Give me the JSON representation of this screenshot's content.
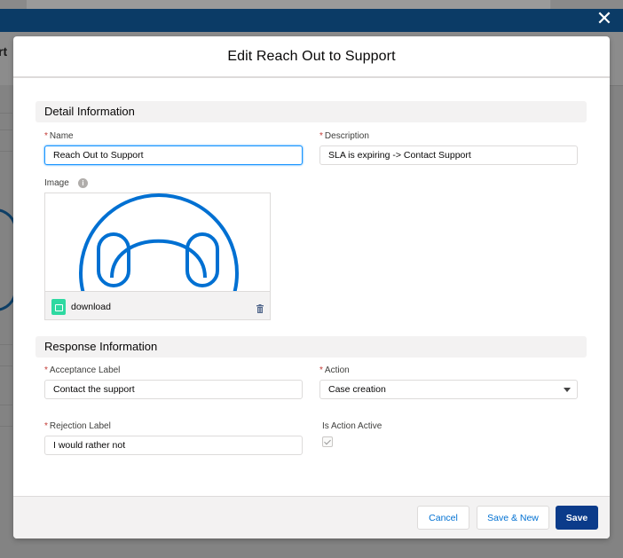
{
  "modal": {
    "title": "Edit Reach Out to Support",
    "close_icon": "close-icon"
  },
  "background": {
    "partial_title": "rt"
  },
  "detail_section": {
    "title": "Detail Information",
    "name": {
      "label": "Name",
      "value": "Reach Out to Support",
      "required": true
    },
    "description": {
      "label": "Description",
      "value": "SLA is expiring -> Contact Support",
      "required": true
    },
    "image": {
      "label": "Image",
      "info_icon": "info-icon",
      "file_name": "download",
      "file_icon": "image-file-icon",
      "delete_icon": "trash-icon",
      "preview_icon": "headset-icon"
    }
  },
  "response_section": {
    "title": "Response Information",
    "acceptance_label": {
      "label": "Acceptance Label",
      "value": "Contact the support",
      "required": true
    },
    "action": {
      "label": "Action",
      "value": "Case creation",
      "required": true
    },
    "rejection_label": {
      "label": "Rejection Label",
      "value": "I would rather not",
      "required": true
    },
    "is_action_active": {
      "label": "Is Action Active",
      "checked": true
    }
  },
  "footer": {
    "cancel_label": "Cancel",
    "save_new_label": "Save & New",
    "save_label": "Save"
  },
  "colors": {
    "brand": "#0b3b8a",
    "link": "#0070d2",
    "required": "#c23934",
    "focus": "#1b96ff",
    "file_icon": "#2ed9a1",
    "headset": "#0070d2"
  }
}
